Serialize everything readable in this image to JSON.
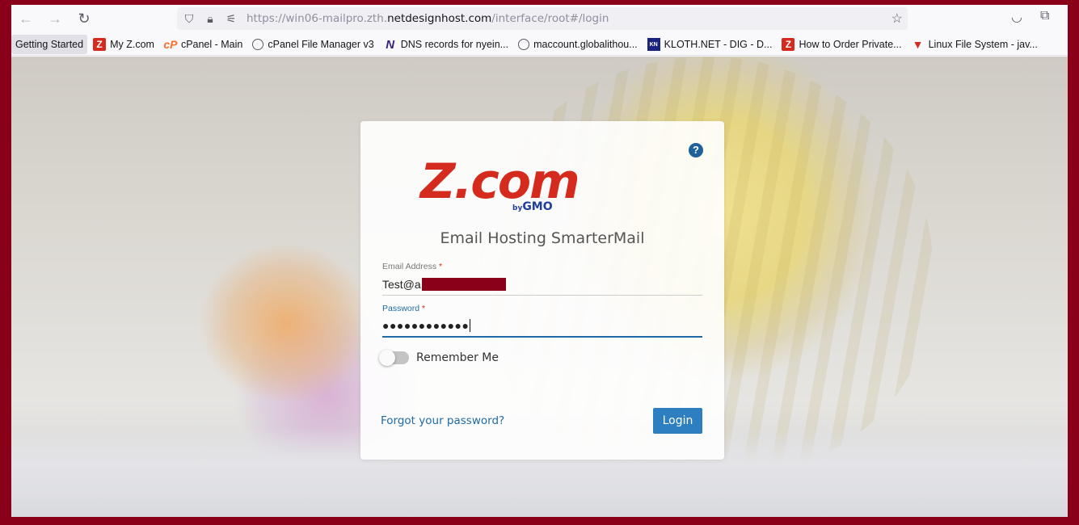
{
  "browser": {
    "url_prefix": "https://win06-mailpro.zth.",
    "url_host": "netdesignhost.com",
    "url_path": "/interface/root#/login"
  },
  "bookmarks": [
    {
      "label": "Getting Started",
      "icon": "none"
    },
    {
      "label": "My Z.com",
      "icon": "zcom-icon"
    },
    {
      "label": "cPanel - Main",
      "icon": "cpanel-icon"
    },
    {
      "label": "cPanel File Manager v3",
      "icon": "globe-icon"
    },
    {
      "label": "DNS records for nyein...",
      "icon": "n-icon"
    },
    {
      "label": "maccount.globalithou...",
      "icon": "globe-icon"
    },
    {
      "label": "KLOTH.NET - DIG - D...",
      "icon": "kloth-icon"
    },
    {
      "label": "How to Order Private...",
      "icon": "zcom-icon"
    },
    {
      "label": "Linux File System - jav...",
      "icon": "triangle-icon"
    }
  ],
  "login": {
    "logo_text": "Z.com",
    "logo_by": "by",
    "logo_brand": "GMO",
    "title": "Email Hosting SmarterMail",
    "email_label": "Email Address",
    "email_value": "Test@a",
    "password_label": "Password",
    "password_value": "●●●●●●●●●●●●",
    "required_mark": "*",
    "remember_label": "Remember Me",
    "remember_on": false,
    "forgot_label": "Forgot your password?",
    "login_label": "Login",
    "help_glyph": "?"
  },
  "colors": {
    "frame": "#8a0019",
    "accent": "#2d7fc1",
    "brand_red": "#d52b1e"
  }
}
